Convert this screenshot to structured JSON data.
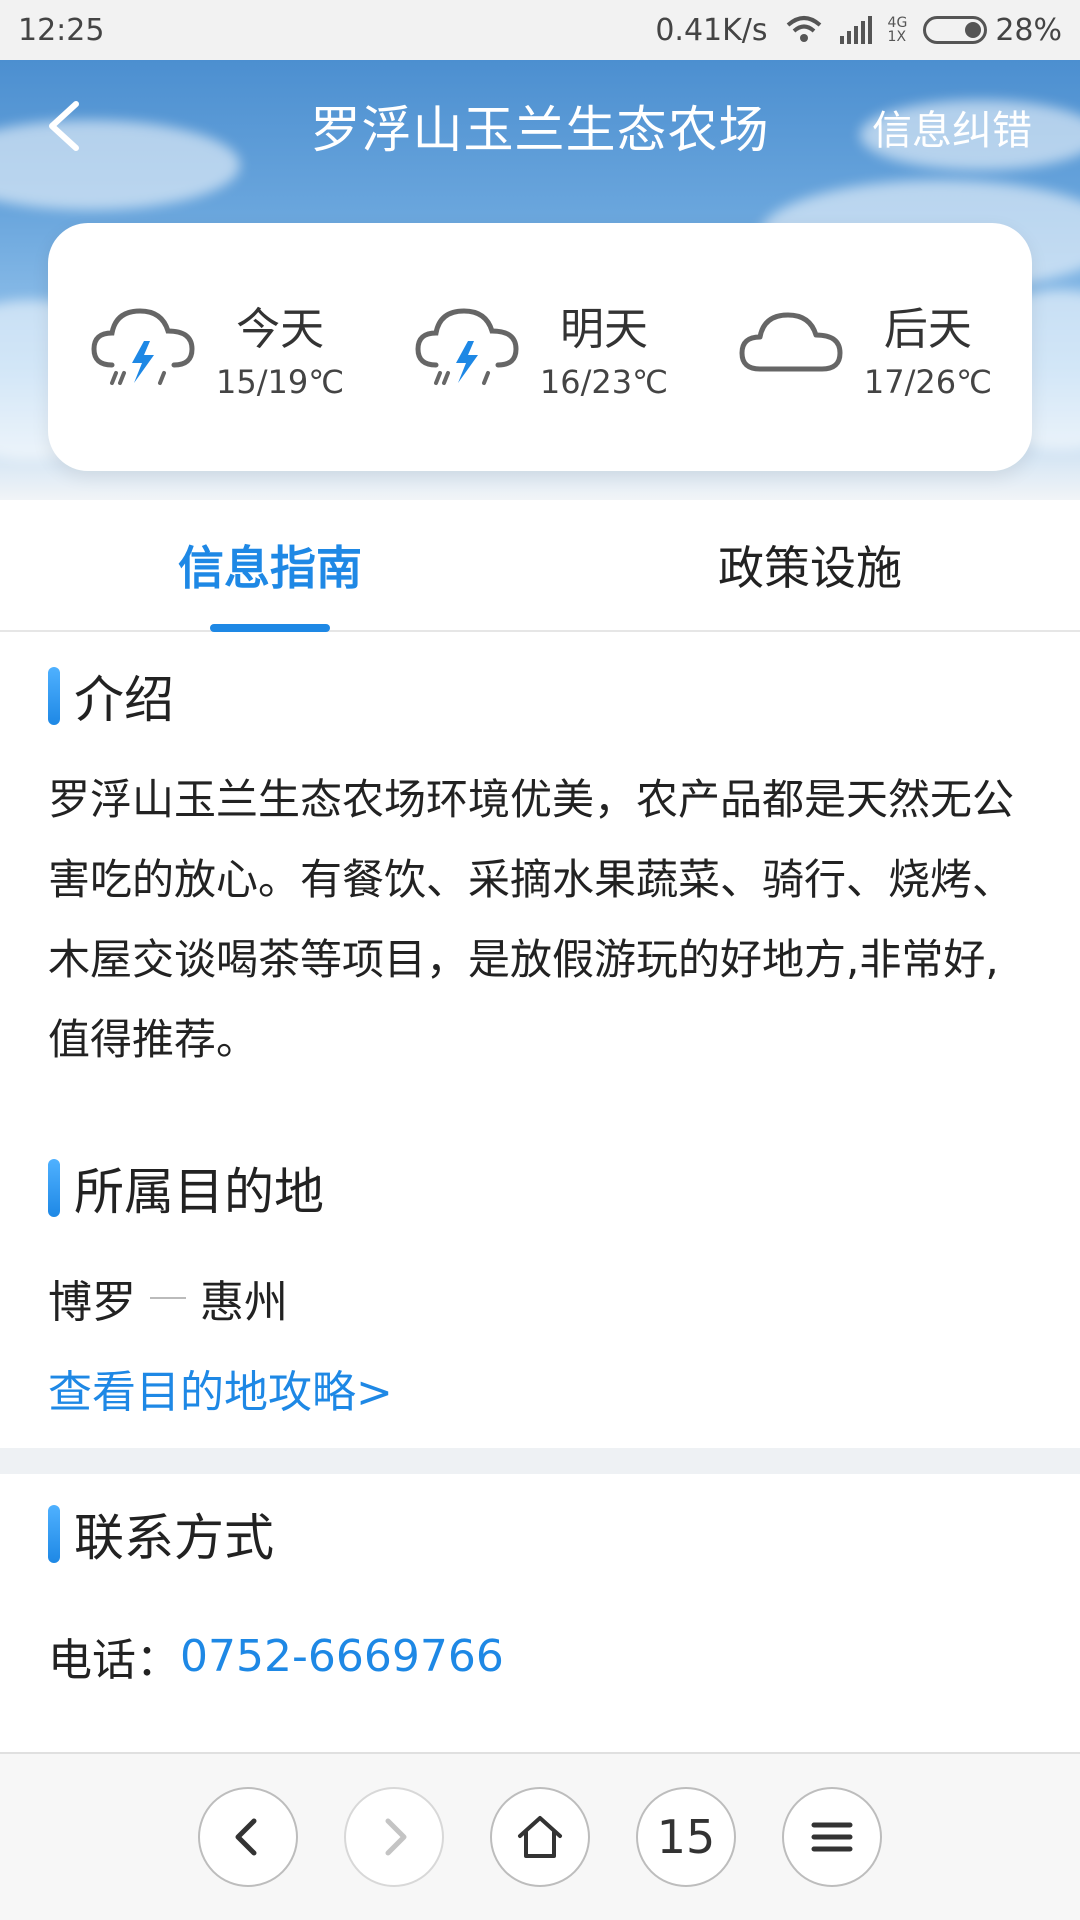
{
  "status_bar": {
    "time": "12:25",
    "speed": "0.41K/s",
    "network_top": "4G",
    "network_bottom": "1X",
    "battery": "28%"
  },
  "header": {
    "title": "罗浮山玉兰生态农场",
    "report_label": "信息纠错",
    "icons": {
      "back": "chevron-left-icon"
    }
  },
  "weather": [
    {
      "day": "今天",
      "temp": "15/19℃",
      "icon": "thunderstorm-icon"
    },
    {
      "day": "明天",
      "temp": "16/23℃",
      "icon": "thunderstorm-icon"
    },
    {
      "day": "后天",
      "temp": "17/26℃",
      "icon": "cloud-icon"
    }
  ],
  "tabs": [
    {
      "label": "信息指南",
      "active": true
    },
    {
      "label": "政策设施",
      "active": false
    }
  ],
  "intro": {
    "title": "介绍",
    "text": "罗浮山玉兰生态农场环境优美，农产品都是天然无公害吃的放心。有餐饮、采摘水果蔬菜、骑行、烧烤、木屋交谈喝茶等项目，是放假游玩的好地方,非常好,值得推荐。"
  },
  "destination": {
    "title": "所属目的地",
    "place": "博罗",
    "city": "惠州",
    "link": "查看目的地攻略>"
  },
  "contact": {
    "title": "联系方式",
    "phone_label": "电话：",
    "phone": "0752-6669766"
  },
  "bottom_bar": {
    "tab_count": "15",
    "icons": [
      "back-icon",
      "forward-icon",
      "home-icon",
      "tabs-count",
      "menu-icon"
    ]
  },
  "colors": {
    "accent": "#1e88e5",
    "text": "#222222",
    "band": "#eef1f4"
  }
}
